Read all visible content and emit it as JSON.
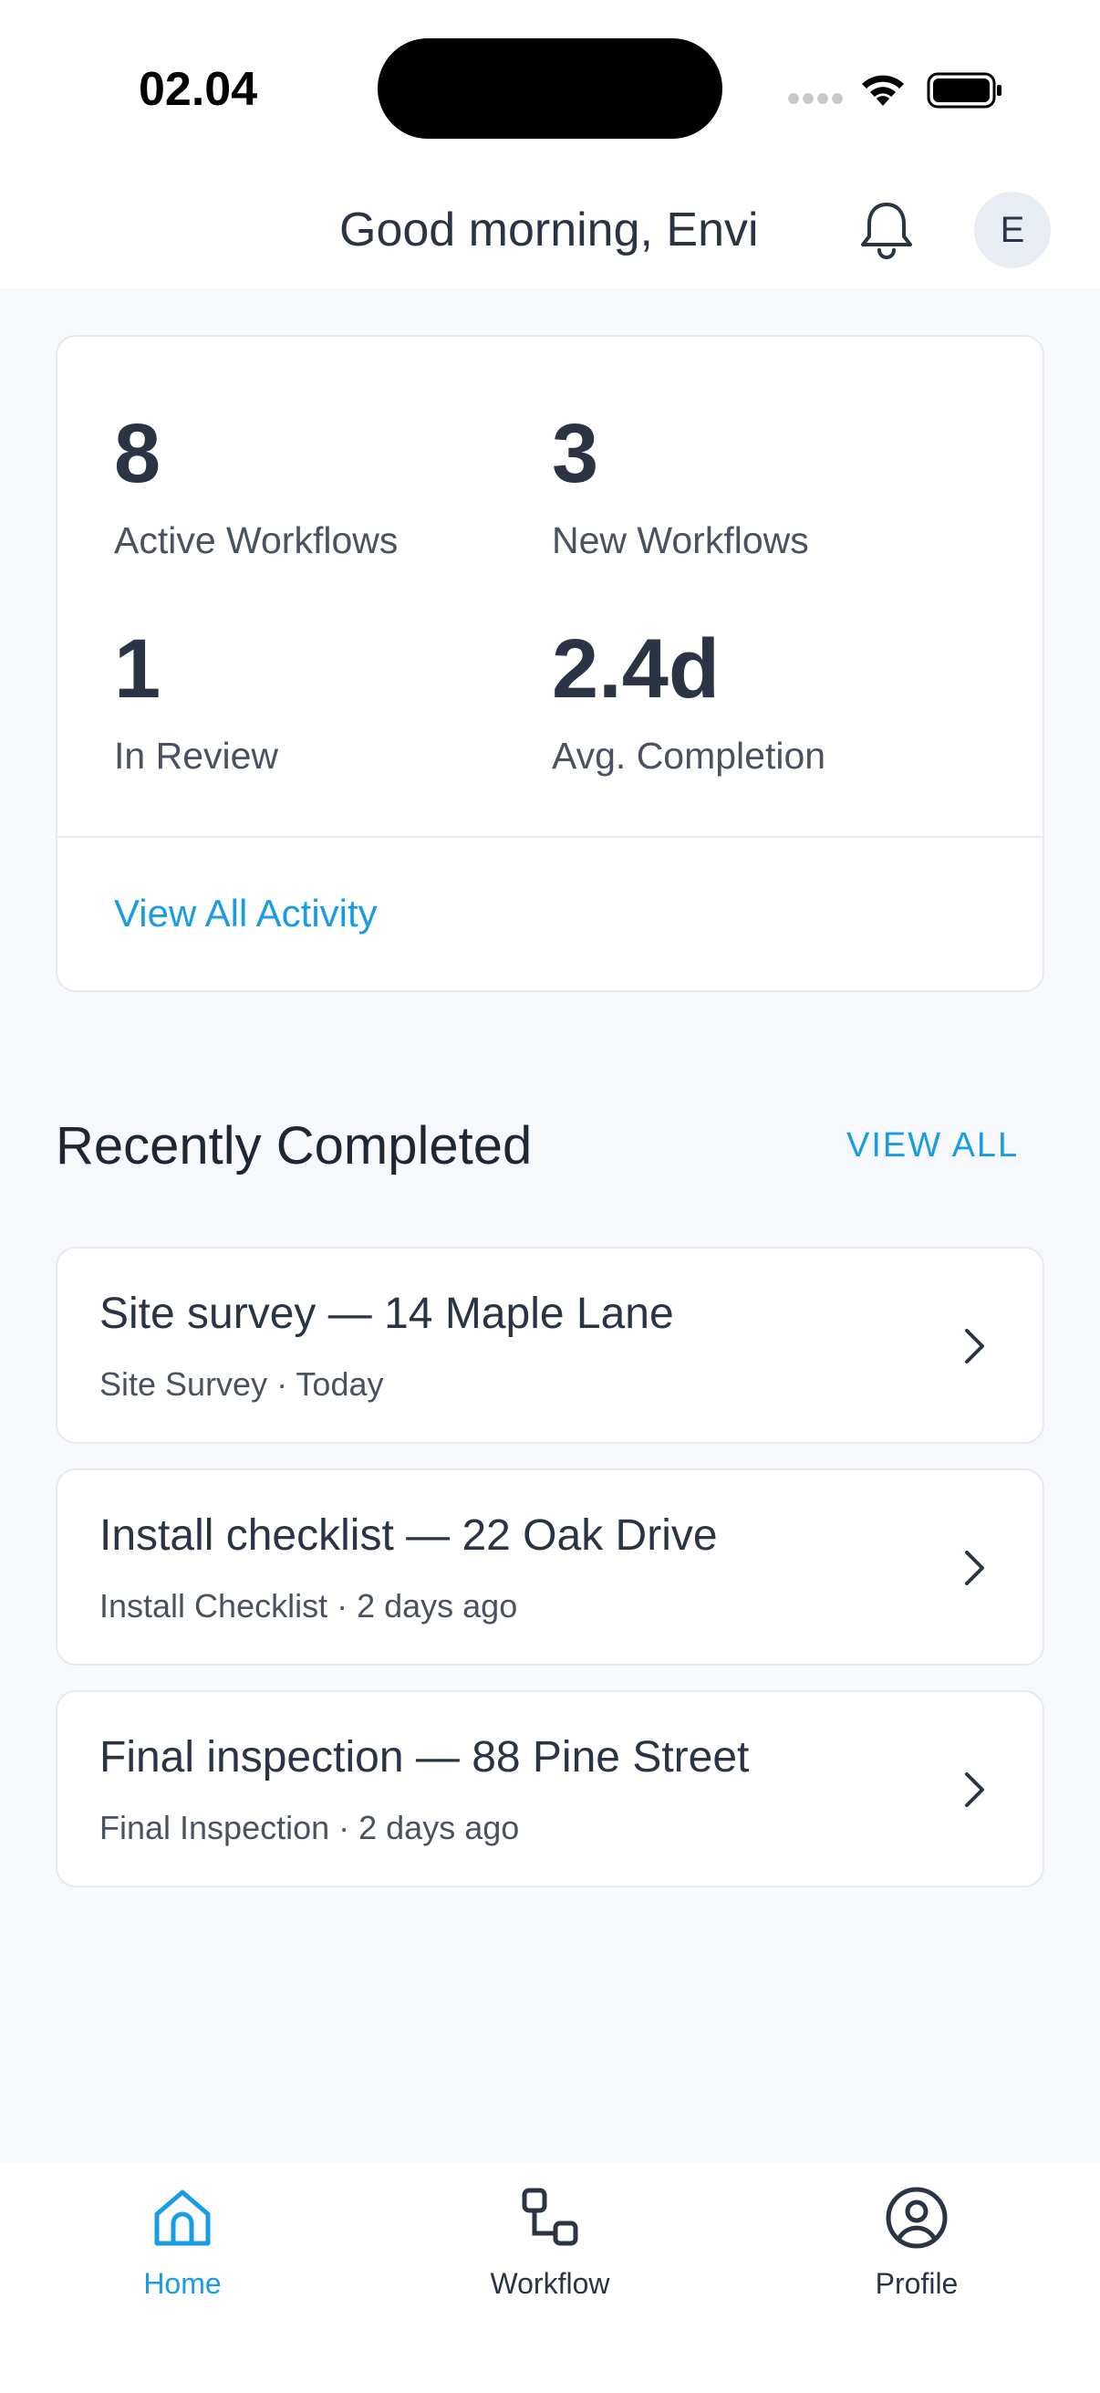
{
  "status_bar": {
    "time": "02.04"
  },
  "header": {
    "greeting": "Good morning, Envi",
    "avatar_initial": "E"
  },
  "stats": [
    {
      "value": "8",
      "label": "Active Workflows"
    },
    {
      "value": "3",
      "label": "New Workflows"
    },
    {
      "value": "1",
      "label": "In Review"
    },
    {
      "value": "2.4d",
      "label": "Avg. Completion"
    }
  ],
  "stats_card": {
    "view_all_activity": "View All Activity"
  },
  "recent": {
    "title": "Recently Completed",
    "view_all": "VIEW ALL",
    "items": [
      {
        "title": "Site survey — 14 Maple Lane",
        "subtitle": "Site Survey · Today"
      },
      {
        "title": "Install checklist — 22 Oak Drive",
        "subtitle": "Install Checklist · 2 days ago"
      },
      {
        "title": "Final inspection — 88 Pine Street",
        "subtitle": "Final Inspection · 2 days ago"
      }
    ]
  },
  "nav": [
    {
      "label": "Home",
      "icon": "home-icon",
      "active": true
    },
    {
      "label": "Workflow",
      "icon": "workflow-icon",
      "active": false
    },
    {
      "label": "Profile",
      "icon": "profile-icon",
      "active": false
    }
  ],
  "colors": {
    "accent": "#1a9be6",
    "text": "#2b3445",
    "background": "#f6f8fb"
  }
}
